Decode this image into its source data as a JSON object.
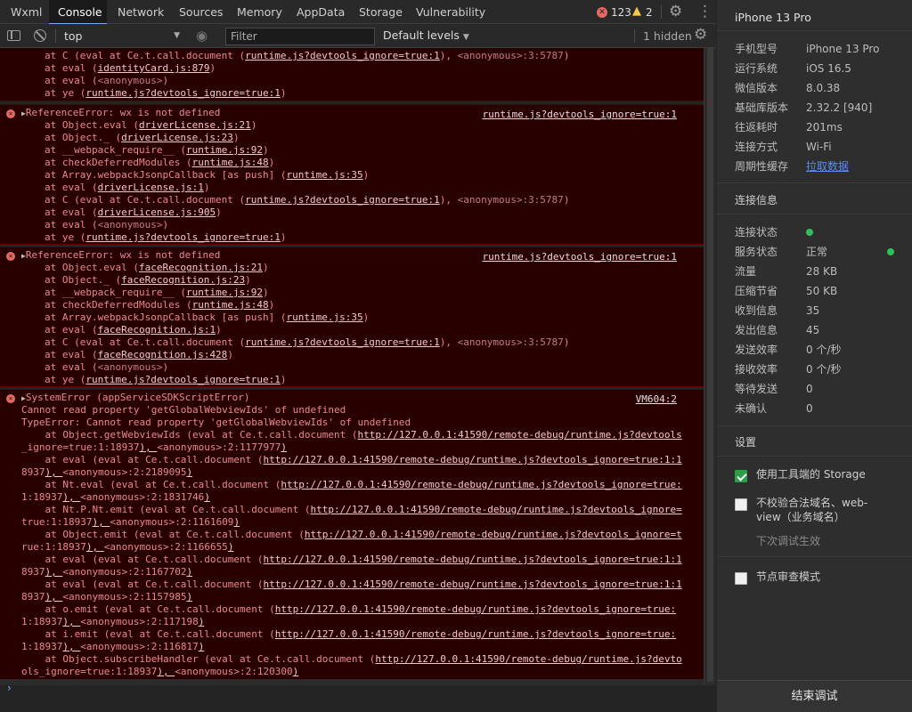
{
  "tabs": {
    "items": [
      "Wxml",
      "Console",
      "Network",
      "Sources",
      "Memory",
      "AppData",
      "Storage",
      "Vulnerability"
    ],
    "active": "Console"
  },
  "issues": {
    "errors": "123",
    "warnings": "2"
  },
  "toolbar": {
    "context": "top",
    "filter_placeholder": "Filter",
    "levels": "Default levels",
    "hidden": "1 hidden"
  },
  "console": {
    "block1": [
      "at C (eval at Ce.t.call.document (|runtime.js?devtools_ignore=true:1|), |<anonymous>:3:5787|)",
      "at eval (|identityCard.js:879|)",
      "at eval (|<anonymous>|)",
      "at ye (|runtime.js?devtools_ignore=true:1|)"
    ],
    "block2_title": "ReferenceError: wx is not defined",
    "block2_source": "runtime.js?devtools_ignore=true:1",
    "block2": [
      "at Object.eval (|driverLicense.js:21|)",
      "at Object._ (|driverLicense.js:23|)",
      "at __webpack_require__ (|runtime.js:92|)",
      "at checkDeferredModules (|runtime.js:48|)",
      "at Array.webpackJsonpCallback [as push] (|runtime.js:35|)",
      "at eval (|driverLicense.js:1|)",
      "at C (eval at Ce.t.call.document (|runtime.js?devtools_ignore=true:1|), |<anonymous>:3:5787|)",
      "at eval (|driverLicense.js:905|)",
      "at eval (|<anonymous>|)",
      "at ye (|runtime.js?devtools_ignore=true:1|)"
    ],
    "block3_title": "ReferenceError: wx is not defined",
    "block3_source": "runtime.js?devtools_ignore=true:1",
    "block3": [
      "at Object.eval (|faceRecognition.js:21|)",
      "at Object._ (|faceRecognition.js:23|)",
      "at __webpack_require__ (|runtime.js:92|)",
      "at checkDeferredModules (|runtime.js:48|)",
      "at Array.webpackJsonpCallback [as push] (|runtime.js:35|)",
      "at eval (|faceRecognition.js:1|)",
      "at C (eval at Ce.t.call.document (|runtime.js?devtools_ignore=true:1|), |<anonymous>:3:5787|)",
      "at eval (|faceRecognition.js:428|)",
      "at eval (|<anonymous>|)",
      "at ye (|runtime.js?devtools_ignore=true:1|)"
    ],
    "block4_title": "SystemError (appServiceSDKScriptError)",
    "block4_source": "VM604:2",
    "block4": [
      "Cannot read property 'getGlobalWebviewIds' of undefined",
      "TypeError: Cannot read property 'getGlobalWebviewIds' of undefined",
      "    at Object.getWebviewIds (eval at Ce.t.call.document (|http://127.0.0.1:41590/remote-debug/runtime.js?devtools|",
      "_ignore=true:1:18937|), |<anonymous>:2:1177977|)",
      "    at eval (eval at Ce.t.call.document (|http://127.0.0.1:41590/remote-debug/runtime.js?devtools_ignore=true:1:1|",
      "8937|), |<anonymous>:2:2189095|)",
      "    at Nt.eval (eval at Ce.t.call.document (|http://127.0.0.1:41590/remote-debug/runtime.js?devtools_ignore=true:|",
      "1:18937|), |<anonymous>:2:1831746|)",
      "    at Nt.P.Nt.emit (eval at Ce.t.call.document (|http://127.0.0.1:41590/remote-debug/runtime.js?devtools_ignore=|",
      "true:1:18937|), |<anonymous>:2:1161609|)",
      "    at Object.emit (eval at Ce.t.call.document (|http://127.0.0.1:41590/remote-debug/runtime.js?devtools_ignore=t|",
      "rue:1:18937|), |<anonymous>:2:1166655|)",
      "    at eval (eval at Ce.t.call.document (|http://127.0.0.1:41590/remote-debug/runtime.js?devtools_ignore=true:1:1|",
      "8937|), |<anonymous>:2:1167702|)",
      "    at eval (eval at Ce.t.call.document (|http://127.0.0.1:41590/remote-debug/runtime.js?devtools_ignore=true:1:1|",
      "8937|), |<anonymous>:2:1157985|)",
      "    at o.emit (eval at Ce.t.call.document (|http://127.0.0.1:41590/remote-debug/runtime.js?devtools_ignore=true:|",
      "1:18937|), |<anonymous>:2:117198|)",
      "    at i.emit (eval at Ce.t.call.document (|http://127.0.0.1:41590/remote-debug/runtime.js?devtools_ignore=true:|",
      "1:18937|), |<anonymous>:2:116817|)",
      "    at Object.subscribeHandler (eval at Ce.t.call.document (|http://127.0.0.1:41590/remote-debug/runtime.js?devto|",
      "ols_ignore=true:1:18937|), |<anonymous>:2:120300|)"
    ]
  },
  "panel": {
    "device": "iPhone 13 Pro",
    "info": [
      {
        "k": "手机型号",
        "v": "iPhone 13 Pro"
      },
      {
        "k": "运行系统",
        "v": "iOS 16.5"
      },
      {
        "k": "微信版本",
        "v": "8.0.38"
      },
      {
        "k": "基础库版本",
        "v": "2.32.2 [940]"
      },
      {
        "k": "往返耗时",
        "v": "201ms"
      },
      {
        "k": "连接方式",
        "v": "Wi-Fi"
      },
      {
        "k": "周期性缓存",
        "v": "拉取数据"
      }
    ],
    "connection_title": "连接信息",
    "conn": [
      {
        "k": "连接状态",
        "v": ""
      },
      {
        "k": "服务状态",
        "v": "正常"
      },
      {
        "k": "流量",
        "v": "28 KB"
      },
      {
        "k": "压缩节省",
        "v": "50 KB"
      },
      {
        "k": "收到信息",
        "v": "35"
      },
      {
        "k": "发出信息",
        "v": "45"
      },
      {
        "k": "发送效率",
        "v": "0 个/秒"
      },
      {
        "k": "接收效率",
        "v": "0 个/秒"
      },
      {
        "k": "等待发送",
        "v": "0"
      },
      {
        "k": "未确认",
        "v": "0"
      }
    ],
    "settings_title": "设置",
    "use_storage": "使用工具端的 Storage",
    "no_check": "不校验合法域名、web-view（业务域名）",
    "no_check_line1": "不校验合法域名、web-",
    "no_check_line2": "view（业务域名）",
    "next_debug": "下次调试生效",
    "node_review": "节点审查模式",
    "end_button": "结束调试"
  }
}
